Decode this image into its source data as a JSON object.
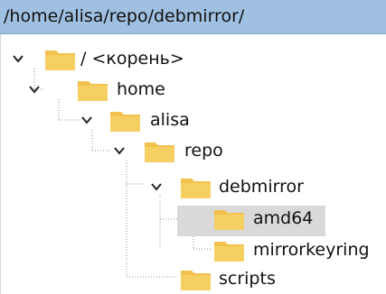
{
  "path_bar": {
    "path": "/home/alisa/repo/debmirror/"
  },
  "tree": {
    "root": {
      "label": "/ <корень>"
    },
    "home": {
      "label": "home"
    },
    "alisa": {
      "label": "alisa"
    },
    "repo": {
      "label": "repo"
    },
    "debmirror": {
      "label": "debmirror",
      "selected": true
    },
    "amd64": {
      "label": "amd64"
    },
    "mirrorkeyring": {
      "label": "mirrorkeyring"
    },
    "scripts": {
      "label": "scripts"
    }
  },
  "colors": {
    "path_bar_bg": "#9fc0e0",
    "folder": "#f2c14e",
    "selection": "#d9d9d9"
  },
  "icons": {
    "expand": "chevron-down-icon",
    "folder": "folder-icon"
  }
}
